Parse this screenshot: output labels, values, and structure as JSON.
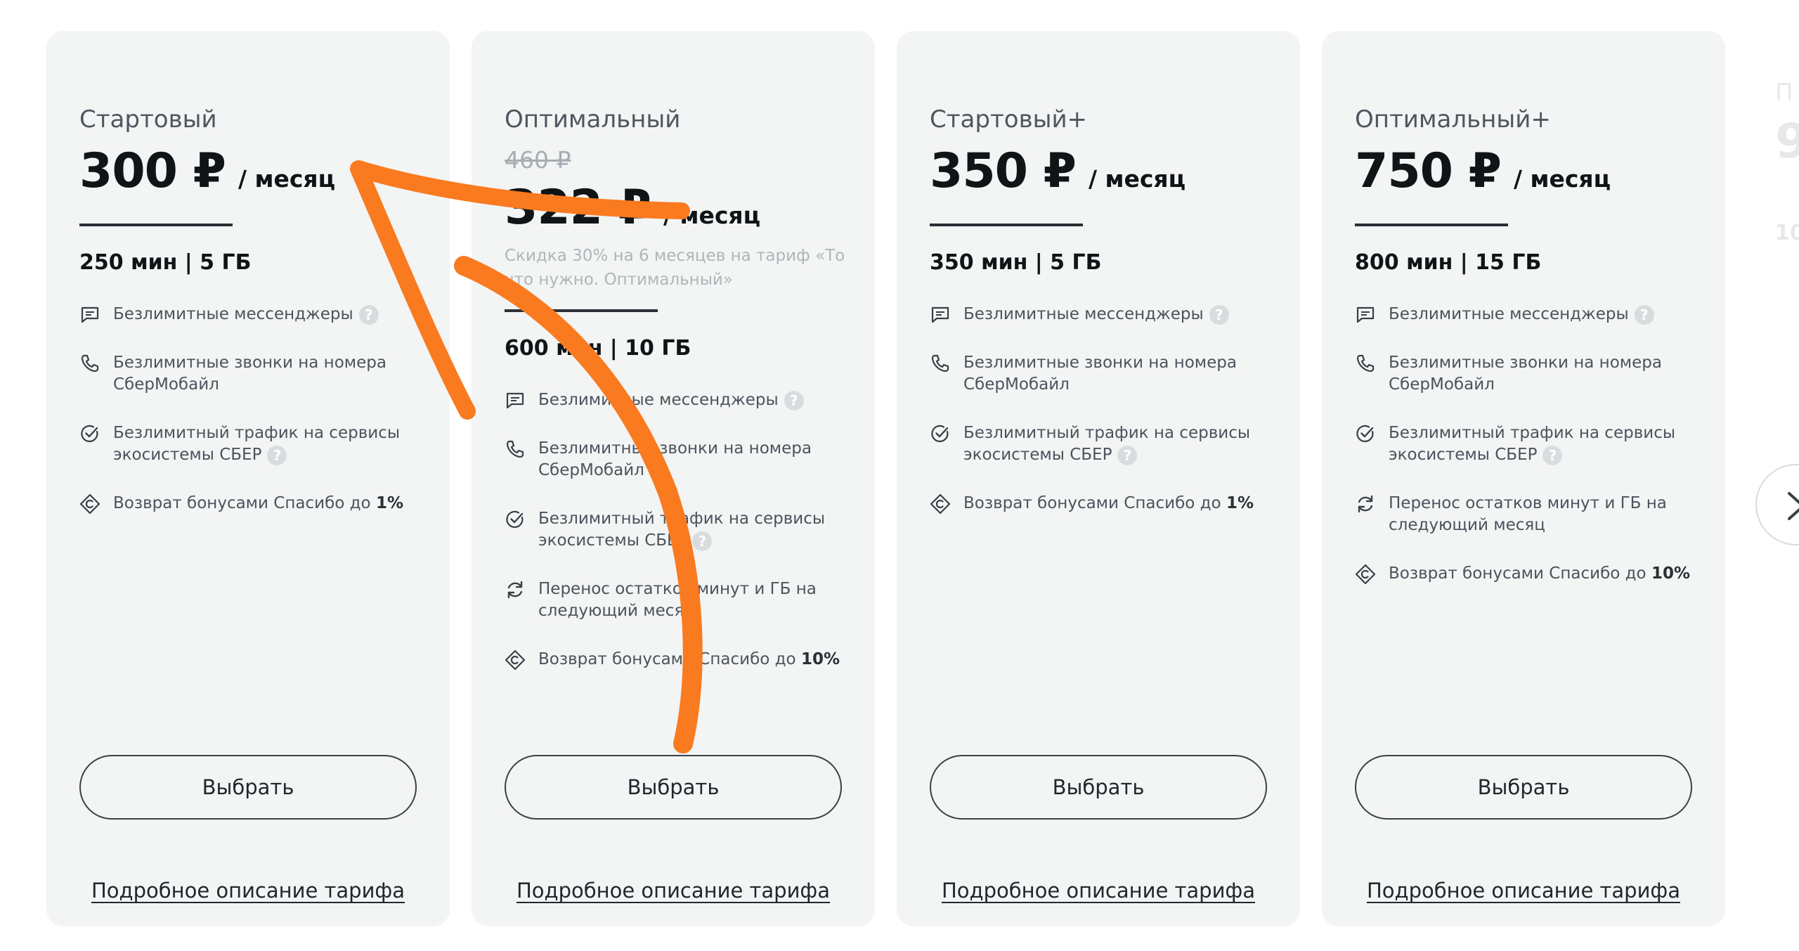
{
  "price_per": "/ месяц",
  "select_label": "Выбрать",
  "details_label": "Подробное описание тарифа",
  "accent_color": "#f97a1f",
  "plans": [
    {
      "name": "Стартовый",
      "price": "300 ₽",
      "minutes": "250 мин | 5 ГБ",
      "features": [
        {
          "icon": "message-icon",
          "text": "Безлимитные мессенджеры",
          "help": "?"
        },
        {
          "icon": "phone-icon",
          "text": "Безлимитные звонки на номера СберМобайл"
        },
        {
          "icon": "check-circle-icon",
          "text": "Безлимитный трафик на сервисы экосистемы СБЕР",
          "help": "?"
        },
        {
          "icon": "bonus-diamond-icon",
          "text": "Возврат бонусами Спасибо до ",
          "bold": "1%"
        }
      ]
    },
    {
      "name": "Оптимальный",
      "old_price": "460 ₽",
      "price": "322 ₽",
      "discount": "Скидка 30% на 6 месяцев на тариф «То что нужно. Оптимальный»",
      "minutes": "600 мин | 10 ГБ",
      "features": [
        {
          "icon": "message-icon",
          "text": "Безлимитные мессенджеры",
          "help": "?"
        },
        {
          "icon": "phone-icon",
          "text": "Безлимитные звонки на номера СберМобайл"
        },
        {
          "icon": "check-circle-icon",
          "text": "Безлимитный трафик на сервисы экосистемы СБЕР",
          "help": "?"
        },
        {
          "icon": "refresh-icon",
          "text": "Перенос остатков минут и ГБ на следующий месяц"
        },
        {
          "icon": "bonus-diamond-icon",
          "text": "Возврат бонусами Спасибо до ",
          "bold": "10%"
        }
      ]
    },
    {
      "name": "Стартовый+",
      "price": "350 ₽",
      "minutes": "350 мин | 5 ГБ",
      "features": [
        {
          "icon": "message-icon",
          "text": "Безлимитные мессенджеры",
          "help": "?"
        },
        {
          "icon": "phone-icon",
          "text": "Безлимитные звонки на номера СберМобайл"
        },
        {
          "icon": "check-circle-icon",
          "text": "Безлимитный трафик на сервисы экосистемы СБЕР",
          "help": "?"
        },
        {
          "icon": "bonus-diamond-icon",
          "text": "Возврат бонусами Спасибо до ",
          "bold": "1%"
        }
      ]
    },
    {
      "name": "Оптимальный+",
      "price": "750 ₽",
      "minutes": "800 мин | 15 ГБ",
      "features": [
        {
          "icon": "message-icon",
          "text": "Безлимитные мессенджеры",
          "help": "?"
        },
        {
          "icon": "phone-icon",
          "text": "Безлимитные звонки на номера СберМобайл"
        },
        {
          "icon": "check-circle-icon",
          "text": "Безлимитный трафик на сервисы экосистемы СБЕР",
          "help": "?"
        },
        {
          "icon": "refresh-icon",
          "text": "Перенос остатков минут и ГБ на следующий месяц"
        },
        {
          "icon": "bonus-diamond-icon",
          "text": "Возврат бонусами Спасибо до ",
          "bold": "10%"
        }
      ]
    }
  ],
  "peek_card": {
    "name_fragment": "П",
    "price_fragment": "9",
    "minutes_fragment": "10"
  },
  "next_icon": "chevron-right-icon"
}
